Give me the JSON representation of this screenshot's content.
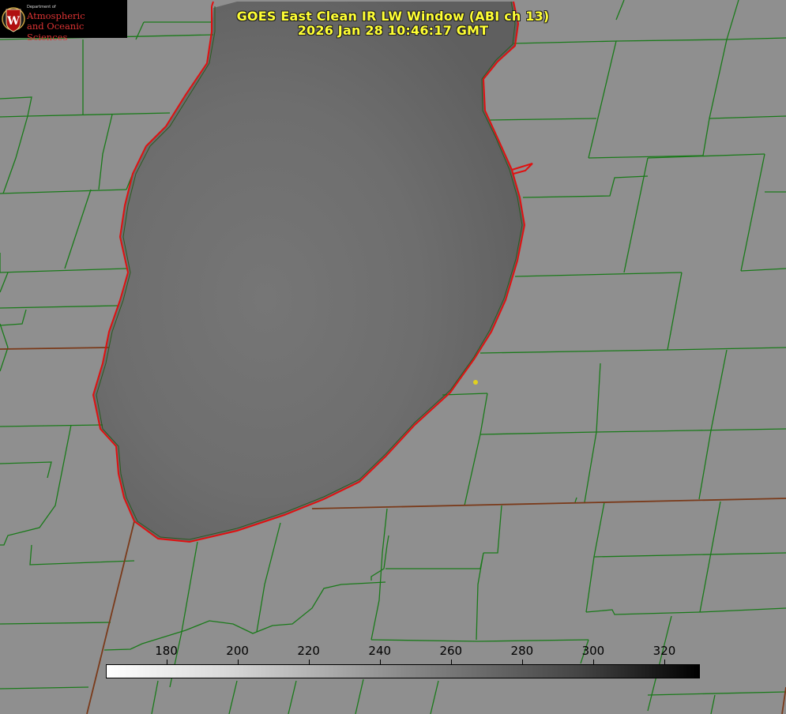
{
  "title": {
    "line1": "GOES East Clean IR LW Window (ABI ch 13)",
    "line2": "2026 Jan 28 10:46:17 GMT"
  },
  "logo": {
    "dept_line": "Department of",
    "name_line1": "Atmospheric",
    "name_line2": "and Oceanic Sciences",
    "seal_letter": "W"
  },
  "colorbar": {
    "min": 163,
    "max": 330,
    "ticks": [
      "180",
      "200",
      "220",
      "240",
      "260",
      "280",
      "300",
      "320"
    ],
    "tick_values": [
      180,
      200,
      220,
      240,
      260,
      280,
      300,
      320
    ],
    "colormap": "white-to-black"
  },
  "map": {
    "background_color": "#8f8f8f",
    "lake_color": "#6c6c6c",
    "county_line_color": "#1a7a1a",
    "state_line_color": "#8a3a1a",
    "coastline_color": "#e01010",
    "station_marker_color": "#e0d020"
  }
}
